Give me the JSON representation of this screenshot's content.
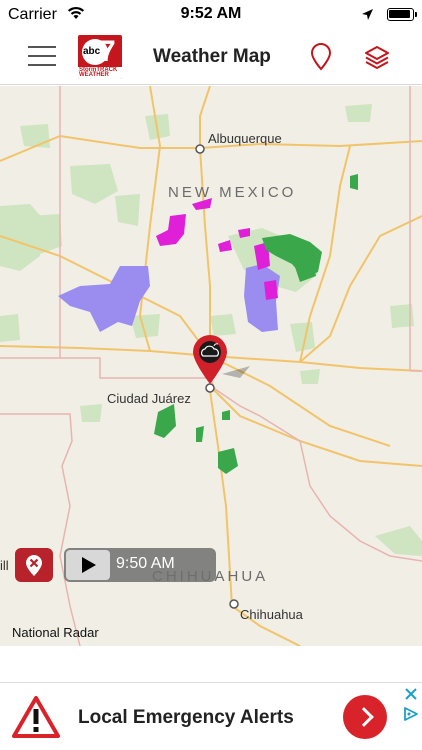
{
  "status_bar": {
    "carrier": "Carrier",
    "time": "9:52 AM"
  },
  "nav": {
    "title": "Weather Map",
    "logo_text": "abc 7",
    "logo_subtext": "StormTRACK WEATHER"
  },
  "map": {
    "cities": [
      "Albuquerque",
      "Ciudad Juárez",
      "Chihuahua"
    ],
    "states": [
      "NEW MEXICO",
      "CHIHUAHUA"
    ],
    "partial_label": "ill",
    "colors": {
      "land": "#f1eee6",
      "forest": "#cfe4c0",
      "highway": "#f2c46a",
      "border": "#e8b4b0",
      "radar_purple": "#9b8cf0",
      "radar_magenta": "#e020d8",
      "radar_green": "#3aa84a",
      "marker": "#d0212a"
    }
  },
  "player": {
    "time": "9:50 AM"
  },
  "legend": {
    "title": "National Radar",
    "colors": [
      "#4d9e52",
      "#7be07c",
      "#4fc05a",
      "#177a1c",
      "#0d5a10",
      "#053d06",
      "#f7f700",
      "#e2a41b",
      "#b85d1b",
      "#e0001b",
      "#a50010",
      "#6e0008",
      "#ff00ff",
      "#7a1cff",
      "#ffffff"
    ]
  },
  "ad": {
    "text": "Local Emergency Alerts"
  }
}
